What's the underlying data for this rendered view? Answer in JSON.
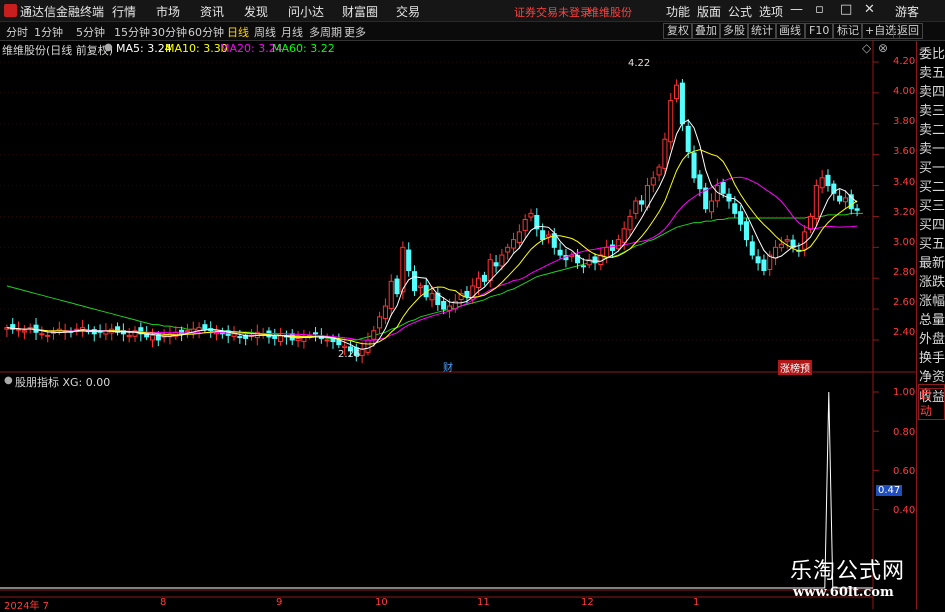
{
  "titlebar": {
    "app_name": "通达信金融终端",
    "menus": [
      "行情",
      "市场",
      "资讯",
      "发现",
      "问小达",
      "财富圈",
      "交易"
    ],
    "notice": "证券交易未登录",
    "stock_name": "维维股份",
    "tools": [
      "功能",
      "版面",
      "公式",
      "选项"
    ],
    "guest": "游客"
  },
  "periods": {
    "items": [
      "分时",
      "1分钟",
      "5分钟",
      "15分钟",
      "30分钟",
      "60分钟",
      "日线",
      "周线",
      "月线",
      "多周期",
      "更多"
    ],
    "active": "日线"
  },
  "toolbar_right": [
    "复权",
    "叠加",
    "多股",
    "统计",
    "画线",
    "F10",
    "标记",
    "+自选",
    "返回"
  ],
  "main_chart": {
    "title": "维维股份(日线 前复权)",
    "ma": [
      {
        "label": "MA5: 3.24",
        "color": "#ffffff"
      },
      {
        "label": "MA10: 3.30",
        "color": "#ffff00"
      },
      {
        "label": "MA20: 3.24",
        "color": "#ff00ff"
      },
      {
        "label": "MA60: 3.22",
        "color": "#00ff00"
      }
    ],
    "high_label": "4.22",
    "low_label": "2.26",
    "marker_cai": "财",
    "marker_zt": "涨榜预"
  },
  "price_axis": [
    "4.20",
    "4.00",
    "3.80",
    "3.60",
    "3.40",
    "3.20",
    "3.00",
    "2.80",
    "2.60",
    "2.40"
  ],
  "indicator": {
    "title": "股朋指标 XG: 0.00",
    "axis": [
      "1.00",
      "0.80",
      "0.60",
      "0.47",
      "0.40"
    ],
    "highlight": "0.47"
  },
  "x_axis": [
    "2024年 7",
    "8",
    "9",
    "10",
    "11",
    "12",
    "1"
  ],
  "side_panel": [
    "委比",
    "卖五",
    "卖四",
    "卖三",
    "卖二",
    "卖一",
    "买一",
    "买二",
    "买三",
    "买四",
    "买五",
    "最新",
    "涨跌",
    "涨幅",
    "总量",
    "外盘",
    "换手",
    "净资",
    "收益"
  ],
  "side_auto": "自动",
  "watermark": {
    "title": "乐淘公式网",
    "url": "www.60lt.com"
  },
  "chart_data": {
    "type": "candlestick",
    "title": "维维股份(日线 前复权)",
    "y_range": [
      2.3,
      4.27
    ],
    "y_ticks": [
      4.2,
      4.0,
      3.8,
      3.6,
      3.4,
      3.2,
      3.0,
      2.8,
      2.6,
      2.4
    ],
    "x_labels": [
      "2024年 7",
      "8",
      "9",
      "10",
      "11",
      "12",
      "1"
    ],
    "annotated_high": 4.22,
    "annotated_low": 2.26,
    "series": [
      {
        "name": "MA5",
        "last": 3.24
      },
      {
        "name": "MA10",
        "last": 3.3
      },
      {
        "name": "MA20",
        "last": 3.24
      },
      {
        "name": "MA60",
        "last": 3.22
      }
    ],
    "closes": [
      2.48,
      2.47,
      2.47,
      2.46,
      2.48,
      2.45,
      2.44,
      2.43,
      2.45,
      2.47,
      2.46,
      2.45,
      2.47,
      2.48,
      2.46,
      2.44,
      2.45,
      2.46,
      2.47,
      2.45,
      2.44,
      2.43,
      2.46,
      2.44,
      2.42,
      2.43,
      2.4,
      2.43,
      2.44,
      2.45,
      2.44,
      2.46,
      2.47,
      2.48,
      2.47,
      2.46,
      2.45,
      2.44,
      2.43,
      2.44,
      2.42,
      2.41,
      2.43,
      2.45,
      2.44,
      2.42,
      2.41,
      2.43,
      2.42,
      2.4,
      2.41,
      2.42,
      2.43,
      2.44,
      2.41,
      2.4,
      2.39,
      2.37,
      2.36,
      2.33,
      2.3,
      2.34,
      2.4,
      2.46,
      2.55,
      2.62,
      2.78,
      2.7,
      3.0,
      2.85,
      2.72,
      2.75,
      2.68,
      2.7,
      2.63,
      2.6,
      2.62,
      2.65,
      2.7,
      2.68,
      2.75,
      2.8,
      2.78,
      2.92,
      2.88,
      2.95,
      3.0,
      3.05,
      3.1,
      3.18,
      3.22,
      3.12,
      3.05,
      3.08,
      3.0,
      2.95,
      2.92,
      2.95,
      2.9,
      2.88,
      2.92,
      2.9,
      2.95,
      3.0,
      2.98,
      3.05,
      3.12,
      3.2,
      3.3,
      3.28,
      3.4,
      3.45,
      3.52,
      3.7,
      3.95,
      4.05,
      3.8,
      3.62,
      3.45,
      3.38,
      3.25,
      3.3,
      3.4,
      3.35,
      3.3,
      3.22,
      3.15,
      3.05,
      2.95,
      2.9,
      2.85,
      2.95,
      3.0,
      3.02,
      3.05,
      3.0,
      2.98,
      3.1,
      3.2,
      3.4,
      3.45,
      3.4,
      3.35,
      3.3,
      3.32,
      3.25,
      3.24
    ],
    "ma60": [
      2.75,
      2.74,
      2.73,
      2.72,
      2.71,
      2.7,
      2.69,
      2.68,
      2.67,
      2.66,
      2.65,
      2.64,
      2.63,
      2.62,
      2.61,
      2.6,
      2.59,
      2.58,
      2.57,
      2.56,
      2.55,
      2.54,
      2.53,
      2.52,
      2.51,
      2.5,
      2.5,
      2.49,
      2.49,
      2.48,
      2.48,
      2.47,
      2.47,
      2.47,
      2.47,
      2.47,
      2.46,
      2.46,
      2.46,
      2.45,
      2.45,
      2.45,
      2.45,
      2.44,
      2.44,
      2.44,
      2.44,
      2.43,
      2.43,
      2.43,
      2.43,
      2.42,
      2.42,
      2.42,
      2.42,
      2.41,
      2.41,
      2.41,
      2.4,
      2.4,
      2.4,
      2.41,
      2.42,
      2.43,
      2.44,
      2.45,
      2.47,
      2.48,
      2.5,
      2.52,
      2.53,
      2.55,
      2.56,
      2.57,
      2.58,
      2.59,
      2.6,
      2.61,
      2.62,
      2.63,
      2.64,
      2.65,
      2.66,
      2.68,
      2.69,
      2.7,
      2.72,
      2.73,
      2.75,
      2.77,
      2.79,
      2.81,
      2.82,
      2.83,
      2.84,
      2.85,
      2.86,
      2.87,
      2.88,
      2.89,
      2.9,
      2.91,
      2.92,
      2.93,
      2.94,
      2.95,
      2.97,
      2.99,
      3.01,
      3.02,
      3.04,
      3.05,
      3.07,
      3.09,
      3.11,
      3.13,
      3.14,
      3.15,
      3.16,
      3.16,
      3.17,
      3.17,
      3.18,
      3.18,
      3.19,
      3.19,
      3.19,
      3.19,
      3.19,
      3.19,
      3.19,
      3.19,
      3.19,
      3.19,
      3.19,
      3.19,
      3.19,
      3.19,
      3.2,
      3.2,
      3.2,
      3.21,
      3.21,
      3.21,
      3.21,
      3.22,
      3.22,
      3.22
    ],
    "indicator_spike": {
      "position": "late Jan",
      "value": 1.0
    }
  }
}
